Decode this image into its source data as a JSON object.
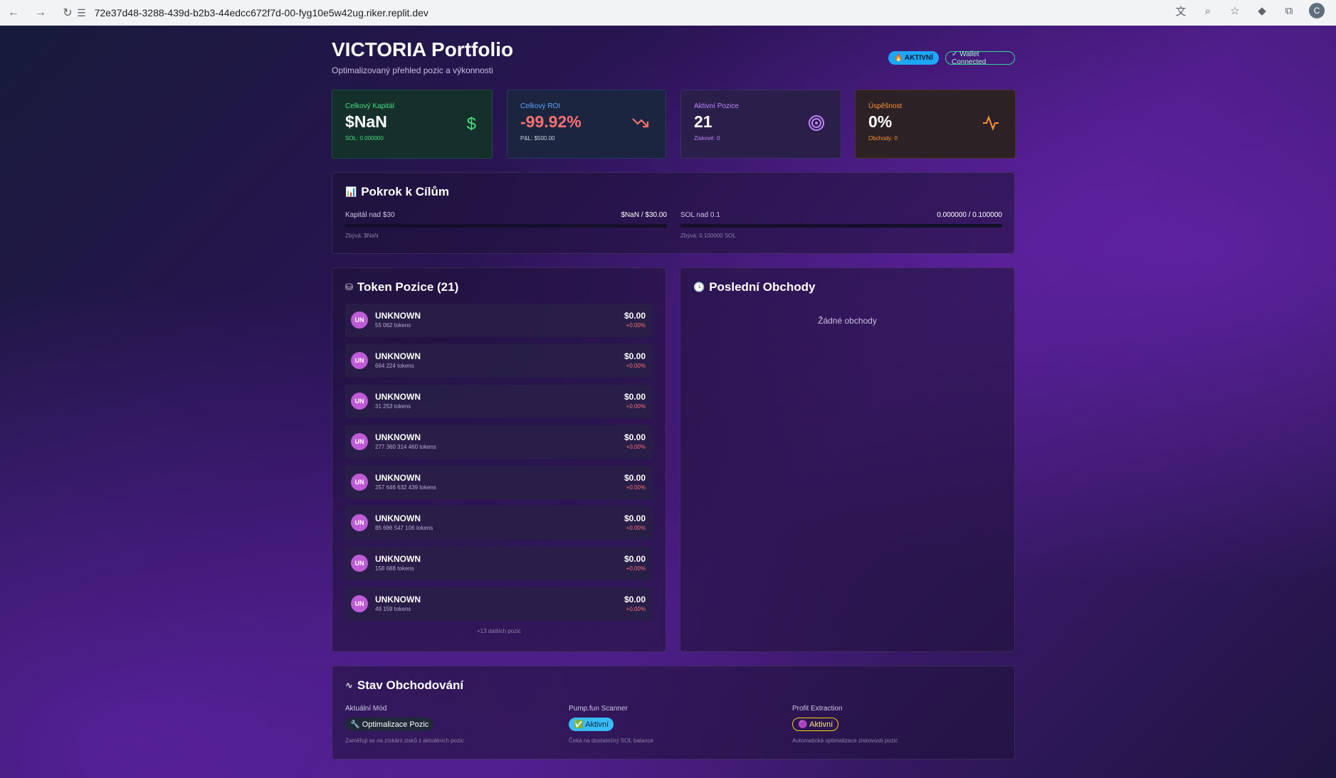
{
  "browser": {
    "url": "72e37d48-3288-439d-b2b3-44edcc672f7d-00-fyg10e5w42ug.riker.replit.dev",
    "avatar": "C"
  },
  "header": {
    "title": "VICTORIA Portfolio",
    "subtitle": "Optimalizovaný přehled pozic a výkonnosti",
    "badge_active": "🔥 AKTIVNÍ",
    "badge_wallet": "✓ Wallet Connected"
  },
  "stats": [
    {
      "label": "Celkový Kapitál",
      "value": "$NaN",
      "sub": "SOL: 0.000000",
      "icon": "dollar-icon"
    },
    {
      "label": "Celkový ROI",
      "value": "-99.92%",
      "sub": "P&L: $500.00",
      "icon": "trending-down-icon"
    },
    {
      "label": "Aktivní Pozice",
      "value": "21",
      "sub": "Ziskové: 0",
      "icon": "target-icon"
    },
    {
      "label": "Úspěšnost",
      "value": "0%",
      "sub": "Obchody: 0",
      "icon": "activity-icon"
    }
  ],
  "goals": {
    "title": "Pokrok k Cílům",
    "items": [
      {
        "label": "Kapitál nad $30",
        "value": "$NaN / $30.00",
        "remaining": "Zbývá: $NaN",
        "progress": 0
      },
      {
        "label": "SOL nad 0.1",
        "value": "0.000000 / 0.100000",
        "remaining": "Zbývá: 0.100000 SOL",
        "progress": 0
      }
    ]
  },
  "tokens": {
    "title": "Token Pozice (21)",
    "items": [
      {
        "initials": "UN",
        "name": "UNKNOWN",
        "amount": "55 062 tokens",
        "usd": "$0.00",
        "change": "+0.00%"
      },
      {
        "initials": "UN",
        "name": "UNKNOWN",
        "amount": "664 224 tokens",
        "usd": "$0.00",
        "change": "+0.00%"
      },
      {
        "initials": "UN",
        "name": "UNKNOWN",
        "amount": "31 253 tokens",
        "usd": "$0.00",
        "change": "+0.00%"
      },
      {
        "initials": "UN",
        "name": "UNKNOWN",
        "amount": "277 360 314 460 tokens",
        "usd": "$0.00",
        "change": "+0.00%"
      },
      {
        "initials": "UN",
        "name": "UNKNOWN",
        "amount": "257 646 632 439 tokens",
        "usd": "$0.00",
        "change": "+0.00%"
      },
      {
        "initials": "UN",
        "name": "UNKNOWN",
        "amount": "85 686 547 106 tokens",
        "usd": "$0.00",
        "change": "+0.00%"
      },
      {
        "initials": "UN",
        "name": "UNKNOWN",
        "amount": "158 688 tokens",
        "usd": "$0.00",
        "change": "+0.00%"
      },
      {
        "initials": "UN",
        "name": "UNKNOWN",
        "amount": "49 159 tokens",
        "usd": "$0.00",
        "change": "+0.00%"
      }
    ],
    "more": "+13 dalších pozic"
  },
  "trades": {
    "title": "Poslední Obchody",
    "empty": "Žádné obchody"
  },
  "status": {
    "title": "Stav Obchodování",
    "cols": [
      {
        "label": "Aktuální Mód",
        "pill": "🔧 Optimalizace Pozic",
        "desc": "Zaměřuji se na získání zisků z aktuálních pozic"
      },
      {
        "label": "Pump.fun Scanner",
        "pill": "✅ Aktivní",
        "desc": "Čeká na dostatečný SOL balance"
      },
      {
        "label": "Profit Extraction",
        "pill": "🟣 Aktivní",
        "desc": "Automatická optimalizace ziskovosti pozic"
      }
    ]
  },
  "colors": {
    "accent": "#8b5cf6",
    "positive": "#4ade80",
    "negative": "#f87171"
  }
}
